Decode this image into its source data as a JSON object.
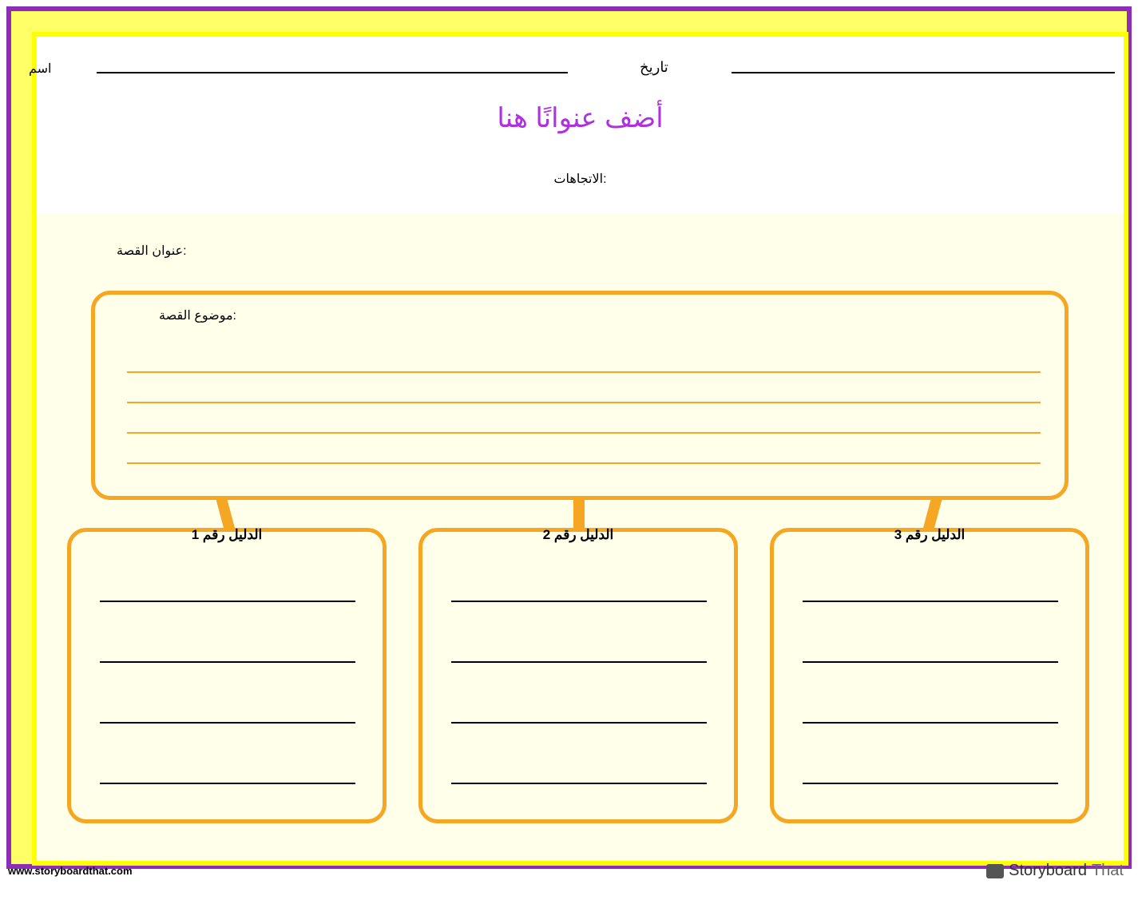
{
  "header": {
    "name_label": "اسم",
    "date_label": "تاريخ",
    "title": "أضف عنوانًا هنا",
    "directions": ":الاتجاهات"
  },
  "story": {
    "title_label": ":عنوان القصة",
    "theme_label": ":موضوع القصة"
  },
  "evidence": {
    "e1_title": "الدليل رقم 1",
    "e2_title": "الدليل رقم 2",
    "e3_title": "الدليل رقم 3"
  },
  "footer": {
    "url": "www.storyboardthat.com",
    "logo_part1": "Storyboard",
    "logo_part2": "That"
  }
}
